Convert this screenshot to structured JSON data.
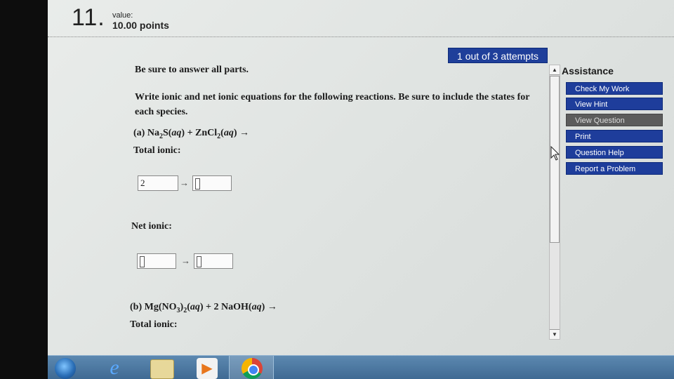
{
  "header": {
    "question_number": "11.",
    "value_label": "value:",
    "points": "10.00 points"
  },
  "attempts": "1 out of 3 attempts",
  "question": {
    "instruction": "Be sure to answer all parts.",
    "prompt": "Write ionic and net ionic equations for the following reactions. Be sure to include the states for each species.",
    "part_a": {
      "label": "(a)",
      "total_ionic_label": "Total ionic:",
      "total_ionic_left_value": "2",
      "total_ionic_arrow": "→",
      "net_ionic_label": "Net ionic:",
      "net_ionic_arrow": "→"
    },
    "part_b": {
      "label": "(b)",
      "total_ionic_label": "Total ionic:"
    }
  },
  "assistance": {
    "title": "Assistance",
    "buttons": [
      {
        "label": "Check My Work"
      },
      {
        "label": "View Hint"
      },
      {
        "label": "View Question"
      },
      {
        "label": "Print"
      },
      {
        "label": "Question Help"
      },
      {
        "label": "Report a Problem"
      }
    ]
  },
  "colors": {
    "button_blue": "#1e3d9b",
    "button_disabled": "#5c5c5c",
    "taskbar": "#3f6a93"
  },
  "icons": [
    "windows-start-icon",
    "internet-explorer-icon",
    "file-explorer-icon",
    "media-player-icon",
    "chrome-icon"
  ]
}
